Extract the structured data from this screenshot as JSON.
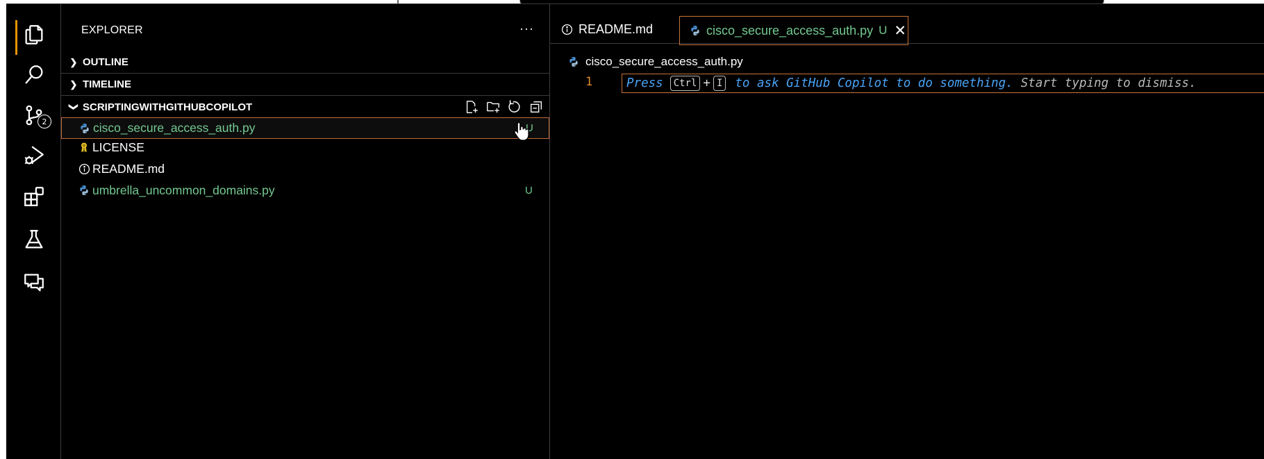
{
  "explorer": {
    "title": "EXPLORER",
    "more_label": "···",
    "sections": {
      "outline": "OUTLINE",
      "timeline": "TIMELINE",
      "project": "SCRIPTINGWITHGITHUBCOPILOT"
    },
    "files": [
      {
        "name": "cisco_secure_access_auth.py",
        "badge": "U",
        "icon": "python-icon"
      },
      {
        "name": "LICENSE",
        "badge": "",
        "icon": "license-icon"
      },
      {
        "name": "README.md",
        "badge": "",
        "icon": "info-icon"
      },
      {
        "name": "umbrella_uncommon_domains.py",
        "badge": "U",
        "icon": "python-icon"
      }
    ]
  },
  "activity_bar": {
    "scm_badge": "2"
  },
  "editor": {
    "tabs": [
      {
        "label": "README.md",
        "icon": "info-icon",
        "modified": "",
        "close": ""
      },
      {
        "label": "cisco_secure_access_auth.py",
        "icon": "python-icon",
        "modified": "U",
        "close": "✕"
      }
    ],
    "breadcrumb": "cisco_secure_access_auth.py",
    "line_number": "1",
    "hint": {
      "press": "Press",
      "key1": "Ctrl",
      "plus": "+",
      "key2": "I",
      "main": "to ask GitHub Copilot to do something.",
      "dismiss": "Start typing to dismiss."
    }
  },
  "colors": {
    "accent_orange": "#c8753a",
    "untracked_green": "#73c991",
    "hint_blue": "#4aa3f5",
    "line_number": "#e08a2c"
  }
}
